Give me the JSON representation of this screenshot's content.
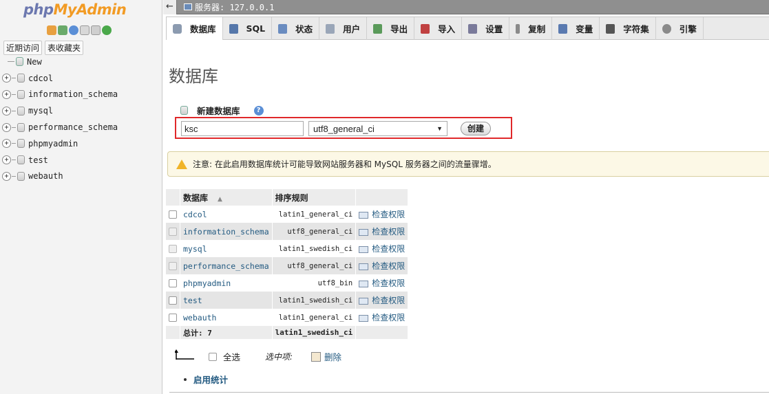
{
  "logo": {
    "part1": "php",
    "part2": "MyAdmin"
  },
  "nav": {
    "tabs": [
      "近期访问",
      "表收藏夹"
    ],
    "new_label": "New",
    "databases": [
      "cdcol",
      "information_schema",
      "mysql",
      "performance_schema",
      "phpmyadmin",
      "test",
      "webauth"
    ]
  },
  "topbar": {
    "back": "←",
    "server": "服务器: 127.0.0.1"
  },
  "tabs": [
    {
      "label": "数据库",
      "icon": "database-icon",
      "color": "#8c9bb0"
    },
    {
      "label": "SQL",
      "icon": "sql-icon",
      "color": "#5577aa"
    },
    {
      "label": "状态",
      "icon": "status-icon",
      "color": "#6a8cc0"
    },
    {
      "label": "用户",
      "icon": "users-icon",
      "color": "#9aa6b8"
    },
    {
      "label": "导出",
      "icon": "export-icon",
      "color": "#5a9a5a"
    },
    {
      "label": "导入",
      "icon": "import-icon",
      "color": "#c04040"
    },
    {
      "label": "设置",
      "icon": "settings-icon",
      "color": "#7a7a9a"
    },
    {
      "label": "复制",
      "icon": "replication-icon",
      "color": "#8a8a8a"
    },
    {
      "label": "变量",
      "icon": "variables-icon",
      "color": "#5a7ab0"
    },
    {
      "label": "字符集",
      "icon": "charset-icon",
      "color": "#555555"
    },
    {
      "label": "引擎",
      "icon": "engine-icon",
      "color": "#8a8a8a"
    }
  ],
  "page": {
    "title": "数据库"
  },
  "create_db": {
    "label": "新建数据库",
    "help": "?",
    "name_value": "ksc",
    "collation_value": "utf8_general_ci",
    "button": "创建"
  },
  "notice": "注意: 在此启用数据库统计可能导致网站服务器和 MySQL 服务器之间的流量骤增。",
  "table": {
    "headers": {
      "db": "数据库",
      "collation": "排序规则"
    },
    "rows": [
      {
        "name": "cdcol",
        "collation": "latin1_general_ci",
        "privileges": "检查权限"
      },
      {
        "name": "information_schema",
        "collation": "utf8_general_ci",
        "privileges": "检查权限"
      },
      {
        "name": "mysql",
        "collation": "latin1_swedish_ci",
        "privileges": "检查权限"
      },
      {
        "name": "performance_schema",
        "collation": "utf8_general_ci",
        "privileges": "检查权限"
      },
      {
        "name": "phpmyadmin",
        "collation": "utf8_bin",
        "privileges": "检查权限"
      },
      {
        "name": "test",
        "collation": "latin1_swedish_ci",
        "privileges": "检查权限"
      },
      {
        "name": "webauth",
        "collation": "latin1_general_ci",
        "privileges": "检查权限"
      }
    ],
    "footer": {
      "total": "总计: 7",
      "collation": "latin1_swedish_ci"
    }
  },
  "actions": {
    "select_all": "全选",
    "with_selected": "选中项:",
    "delete": "删除",
    "enable_stats": "启用统计"
  }
}
